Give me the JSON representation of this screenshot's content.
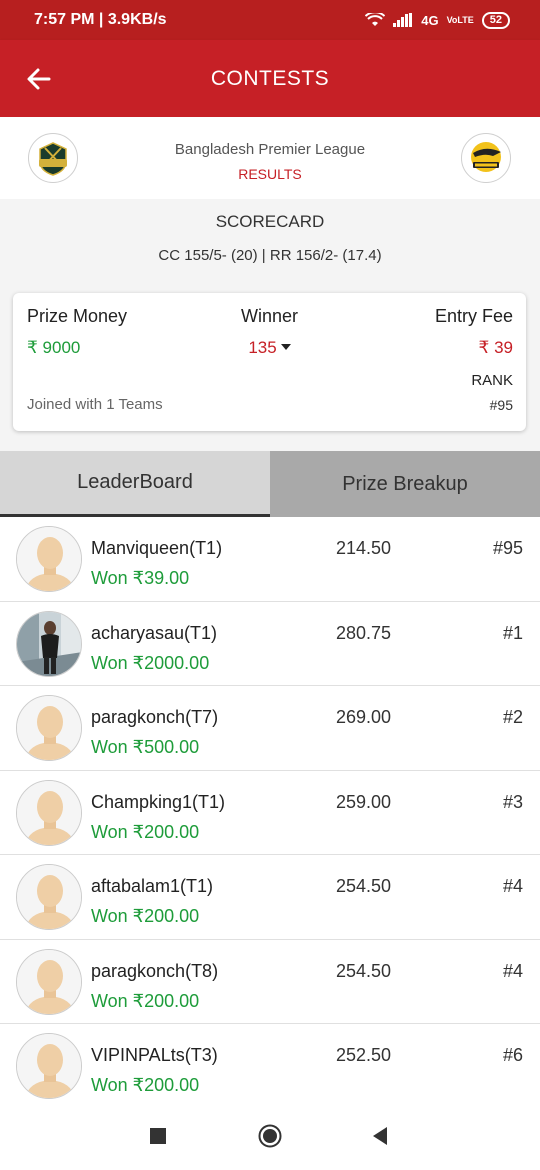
{
  "status_bar": {
    "time_speed": "7:57 PM | 3.9KB/s",
    "network": "4G",
    "volte": "VoLTE",
    "battery": "52"
  },
  "app_bar": {
    "title": "CONTESTS"
  },
  "match": {
    "league": "Bangladesh Premier League",
    "status": "RESULTS",
    "team_left_logo_text": "CHATTOGRAM CHALLENGERS",
    "team_right_logo_text": "RAJSHAHI ROYALS"
  },
  "scorecard": {
    "title": "SCORECARD",
    "line": "CC 155/5- (20)  |  RR 156/2- (17.4)"
  },
  "prize_card": {
    "prize_money_label": "Prize Money",
    "prize_money_value": "₹ 9000",
    "winner_label": "Winner",
    "winner_value": "135",
    "entry_fee_label": "Entry Fee",
    "entry_fee_value": "₹ 39",
    "rank_label": "RANK",
    "rank_value": "#95",
    "joined_text": "Joined with 1 Teams"
  },
  "tabs": [
    {
      "label": "LeaderBoard",
      "active": true
    },
    {
      "label": "Prize Breakup",
      "active": false
    }
  ],
  "leaderboard": [
    {
      "name": "Manviqueen(T1)",
      "won": "Won ₹39.00",
      "points": "214.50",
      "rank": "#95",
      "avatar": "default"
    },
    {
      "name": "acharyasau(T1)",
      "won": "Won ₹2000.00",
      "points": "280.75",
      "rank": "#1",
      "avatar": "photo"
    },
    {
      "name": "paragkonch(T7)",
      "won": "Won ₹500.00",
      "points": "269.00",
      "rank": "#2",
      "avatar": "default"
    },
    {
      "name": "Champking1(T1)",
      "won": "Won ₹200.00",
      "points": "259.00",
      "rank": "#3",
      "avatar": "default"
    },
    {
      "name": "aftabalam1(T1)",
      "won": "Won ₹200.00",
      "points": "254.50",
      "rank": "#4",
      "avatar": "default"
    },
    {
      "name": "paragkonch(T8)",
      "won": "Won ₹200.00",
      "points": "254.50",
      "rank": "#4",
      "avatar": "default"
    },
    {
      "name": "VIPINPALts(T3)",
      "won": "Won ₹200.00",
      "points": "252.50",
      "rank": "#6",
      "avatar": "default"
    }
  ],
  "colors": {
    "primary_red": "#c62026",
    "won_green": "#1e9c3a",
    "tab_active_bg": "#d6d6d6",
    "tab_inactive_bg": "#a9a9a9"
  }
}
